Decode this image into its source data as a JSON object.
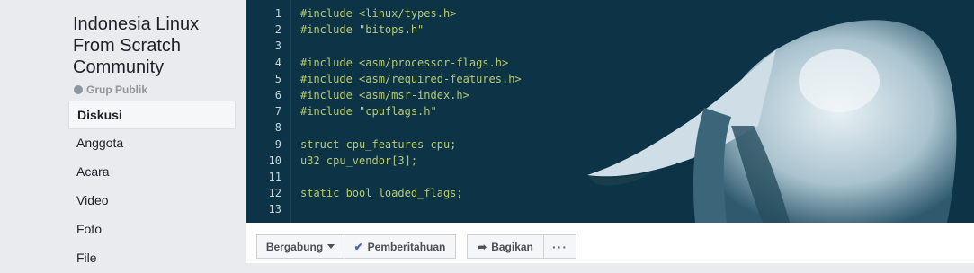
{
  "group": {
    "name": "Indonesia Linux From Scratch Community",
    "privacy": "Grup Publik",
    "privacy_icon": "globe-icon"
  },
  "nav": {
    "items": [
      {
        "label": "Diskusi",
        "active": true
      },
      {
        "label": "Anggota"
      },
      {
        "label": "Acara"
      },
      {
        "label": "Video"
      },
      {
        "label": "Foto"
      },
      {
        "label": "File"
      }
    ]
  },
  "cover": {
    "code_lines": [
      {
        "n": "1",
        "text": "#include <linux/types.h>"
      },
      {
        "n": "2",
        "text": "#include \"bitops.h\""
      },
      {
        "n": "3",
        "text": ""
      },
      {
        "n": "4",
        "text": "#include <asm/processor-flags.h>"
      },
      {
        "n": "5",
        "text": "#include <asm/required-features.h>"
      },
      {
        "n": "6",
        "text": "#include <asm/msr-index.h>"
      },
      {
        "n": "7",
        "text": "#include \"cpuflags.h\""
      },
      {
        "n": "8",
        "text": ""
      },
      {
        "n": "9",
        "text": "struct cpu_features cpu;"
      },
      {
        "n": "10",
        "text": "u32 cpu_vendor[3];"
      },
      {
        "n": "11",
        "text": ""
      },
      {
        "n": "12",
        "text": "static bool loaded_flags;"
      },
      {
        "n": "13",
        "text": ""
      }
    ]
  },
  "actions": {
    "join": "Bergabung",
    "notifications": "Pemberitahuan",
    "share": "Bagikan",
    "more": "···"
  },
  "colors": {
    "cover_bg": "#0c3446",
    "code_text": "#b8c96f",
    "accent": "#4267b2"
  }
}
